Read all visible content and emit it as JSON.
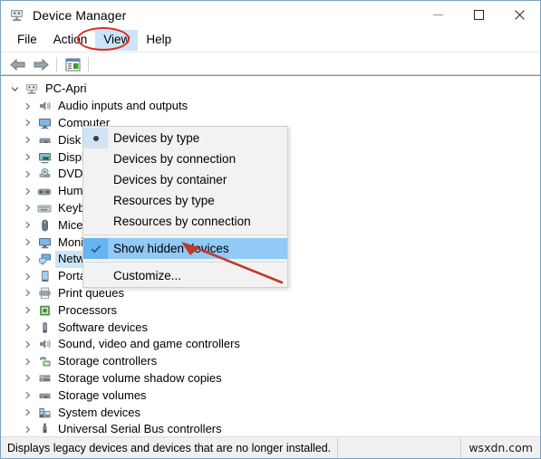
{
  "window": {
    "title": "Device Manager",
    "icon": "device-manager-icon",
    "controls": {
      "minimize": "minimize-icon",
      "maximize": "maximize-icon",
      "close": "close-icon"
    }
  },
  "menubar": {
    "items": [
      {
        "label": "File",
        "open": false
      },
      {
        "label": "Action",
        "open": false
      },
      {
        "label": "View",
        "open": true
      },
      {
        "label": "Help",
        "open": false
      }
    ]
  },
  "toolbar": {
    "buttons": [
      {
        "name": "back-arrow-icon",
        "label": "Back"
      },
      {
        "name": "forward-arrow-icon",
        "label": "Forward"
      },
      {
        "name": "properties-icon",
        "label": "Properties"
      }
    ]
  },
  "view_menu": {
    "items": [
      {
        "label": "Devices by type",
        "marker": "radio",
        "checked": true,
        "highlight": false
      },
      {
        "label": "Devices by connection",
        "marker": "none",
        "checked": false,
        "highlight": false
      },
      {
        "label": "Devices by container",
        "marker": "none",
        "checked": false,
        "highlight": false
      },
      {
        "label": "Resources by type",
        "marker": "none",
        "checked": false,
        "highlight": false
      },
      {
        "label": "Resources by connection",
        "marker": "none",
        "checked": false,
        "highlight": false
      },
      {
        "separator": true
      },
      {
        "label": "Show hidden devices",
        "marker": "check",
        "checked": true,
        "highlight": true
      },
      {
        "separator": true
      },
      {
        "label": "Customize...",
        "marker": "none",
        "checked": false,
        "highlight": false
      }
    ]
  },
  "tree": {
    "root": {
      "label": "PC-Apri",
      "icon": "computer-icon",
      "expanded": true
    },
    "items": [
      {
        "label": "Audio inputs and outputs",
        "icon": "speaker-icon",
        "selected": false
      },
      {
        "label": "Computer",
        "icon": "monitor-icon",
        "selected": false
      },
      {
        "label": "Disk drives",
        "icon": "disk-icon",
        "selected": false
      },
      {
        "label": "Display adapters",
        "icon": "display-adapter-icon",
        "selected": false
      },
      {
        "label": "DVD/CD-ROM drives",
        "icon": "dvd-icon",
        "selected": false
      },
      {
        "label": "Human Interface Devices",
        "icon": "hid-icon",
        "selected": false
      },
      {
        "label": "Keyboards",
        "icon": "keyboard-icon",
        "selected": false
      },
      {
        "label": "Mice and other pointing devices",
        "icon": "mouse-icon",
        "selected": false
      },
      {
        "label": "Monitors",
        "icon": "monitor-icon",
        "selected": false
      },
      {
        "label": "Network adapters",
        "icon": "network-icon",
        "selected": true
      },
      {
        "label": "Portable Devices",
        "icon": "portable-device-icon",
        "selected": false
      },
      {
        "label": "Print queues",
        "icon": "printer-icon",
        "selected": false
      },
      {
        "label": "Processors",
        "icon": "processor-icon",
        "selected": false
      },
      {
        "label": "Software devices",
        "icon": "software-device-icon",
        "selected": false
      },
      {
        "label": "Sound, video and game controllers",
        "icon": "speaker-icon",
        "selected": false
      },
      {
        "label": "Storage controllers",
        "icon": "storage-controller-icon",
        "selected": false
      },
      {
        "label": "Storage volume shadow copies",
        "icon": "disk-icon",
        "selected": false
      },
      {
        "label": "Storage volumes",
        "icon": "disk-icon",
        "selected": false
      },
      {
        "label": "System devices",
        "icon": "system-device-icon",
        "selected": false
      },
      {
        "label": "Universal Serial Bus controllers",
        "icon": "usb-icon",
        "selected": false
      }
    ]
  },
  "statusbar": {
    "message": "Displays legacy devices and devices that are no longer installed.",
    "watermark": "wsxdn.com"
  },
  "annotations": {
    "ellipse_target": "View",
    "arrow_target": "Show hidden devices",
    "color": "#e02b20"
  }
}
